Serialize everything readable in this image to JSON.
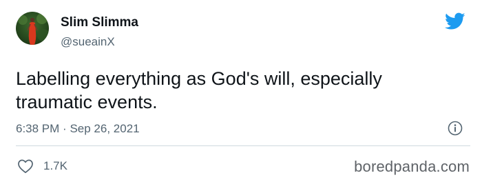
{
  "user": {
    "display_name": "Slim Slimma",
    "handle": "@sueainX",
    "avatar": "profile-photo"
  },
  "tweet": {
    "text": "Labelling everything as God's will, especially traumatic events.",
    "time": "6:38 PM",
    "separator": "·",
    "date": "Sep 26, 2021",
    "likes": "1.7K"
  },
  "icons": {
    "brand": "twitter-bird-icon",
    "info": "info-icon",
    "like": "heart-icon"
  },
  "watermark": "boredpanda.com",
  "colors": {
    "twitter_blue": "#1d9bf0",
    "text": "#0f1419",
    "secondary": "#536471",
    "divider": "#cfd9de"
  }
}
